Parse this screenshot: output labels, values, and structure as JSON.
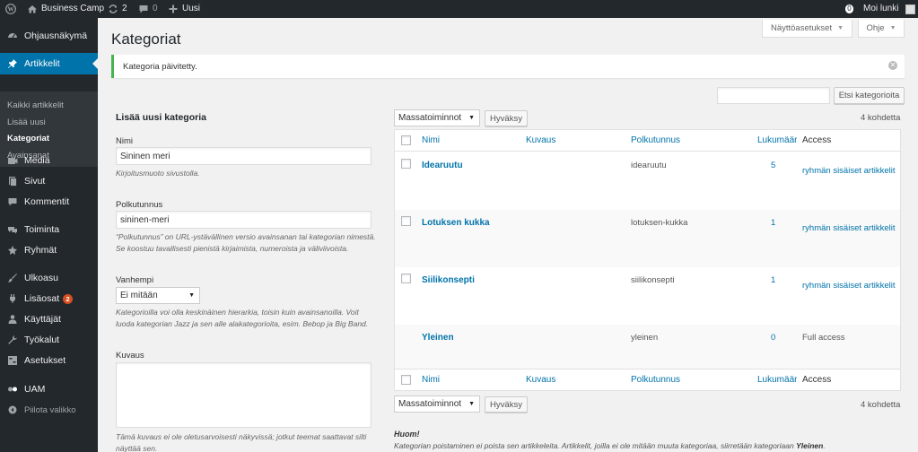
{
  "adminbar": {
    "site_name": "Business Camp",
    "updates_count": "2",
    "comments_count": "0",
    "new_label": "Uusi",
    "notif_count": "0",
    "greeting": "Moi lunki"
  },
  "sidebar": {
    "items": [
      {
        "label": "Ohjausnäkymä",
        "icon": "dashboard-icon"
      },
      {
        "label": "Artikkelit",
        "icon": "pin-icon"
      },
      {
        "label": "Media",
        "icon": "media-icon"
      },
      {
        "label": "Sivut",
        "icon": "page-icon"
      },
      {
        "label": "Kommentit",
        "icon": "comment-icon"
      },
      {
        "label": "Toiminta",
        "icon": "activity-icon"
      },
      {
        "label": "Ryhmät",
        "icon": "groups-icon"
      },
      {
        "label": "Ulkoasu",
        "icon": "appearance-icon"
      },
      {
        "label": "Lisäosat",
        "icon": "plugins-icon",
        "badge": "2"
      },
      {
        "label": "Käyttäjät",
        "icon": "users-icon"
      },
      {
        "label": "Työkalut",
        "icon": "tools-icon"
      },
      {
        "label": "Asetukset",
        "icon": "settings-icon"
      },
      {
        "label": "UAM",
        "icon": "uam-icon"
      }
    ],
    "submenu": [
      "Kaikki artikkelit",
      "Lisää uusi",
      "Kategoriat",
      "Avainsanat"
    ],
    "collapse_label": "Piilota valikko"
  },
  "screen_options_label": "Näyttöasetukset",
  "help_label": "Ohje",
  "page_title": "Kategoriat",
  "notice": "Kategoria päivitetty.",
  "search": {
    "value": "",
    "button_label": "Etsi kategorioita"
  },
  "form": {
    "heading": "Lisää uusi kategoria",
    "name_label": "Nimi",
    "name_value": "Sininen meri",
    "name_desc": "Kirjoitusmuoto sivustolla.",
    "slug_label": "Polkutunnus",
    "slug_value": "sininen-meri",
    "slug_desc_1": "“Polkutunnus” on URL-ystävällinen versio avainsanan tai kategorian nimestä.",
    "slug_desc_2": "Se koostuu tavallisesti pienistä kirjaimista, numeroista ja väliviivoista.",
    "parent_label": "Vanhempi",
    "parent_value": "Ei mitään",
    "parent_desc_1": "Kategorioilla voi olla keskinäinen hierarkia, toisin kuin avainsanoilla. Voit",
    "parent_desc_2": "luoda kategorian Jazz ja sen alle alakategorioita, esim. Bebop ja Big Band.",
    "description_label": "Kuvaus",
    "description_value": "",
    "description_desc_1": "Tämä kuvaus ei ole oletusarvoisesti näkyvissä; jotkut teemat saattavat silti",
    "description_desc_2": "näyttää sen."
  },
  "bulk": {
    "select_value": "Massatoiminnot",
    "apply_label": "Hyväksy",
    "item_count": "4 kohdetta"
  },
  "table": {
    "columns": [
      "Nimi",
      "Kuvaus",
      "Polkutunnus",
      "Lukumäärä",
      "Access"
    ],
    "rows": [
      {
        "name": "Idearuutu",
        "description": "",
        "slug": "idearuutu",
        "count": "5",
        "access": "ryhmän sisäiset artikkelit",
        "access_link": true
      },
      {
        "name": "Lotuksen kukka",
        "description": "",
        "slug": "lotuksen-kukka",
        "count": "1",
        "access": "ryhmän sisäiset artikkelit",
        "access_link": true
      },
      {
        "name": "Siilikonsepti",
        "description": "",
        "slug": "siilikonsepti",
        "count": "1",
        "access": "ryhmän sisäiset artikkelit",
        "access_link": true
      },
      {
        "name": "Yleinen",
        "description": "",
        "slug": "yleinen",
        "count": "0",
        "access": "Full access",
        "access_link": false
      }
    ]
  },
  "note": {
    "heading": "Huom!",
    "text": "Kategorian poistaminen ei poista sen artikkeleita. Artikkelit, joilla ei ole mitään muuta kategoriaa, siirretään kategoriaan ",
    "default_category": "Yleinen",
    "suffix": "."
  },
  "colors": {
    "admin_bar": "#23282d",
    "accent": "#0073aa",
    "success": "#46b450",
    "badge": "#d54e21"
  }
}
